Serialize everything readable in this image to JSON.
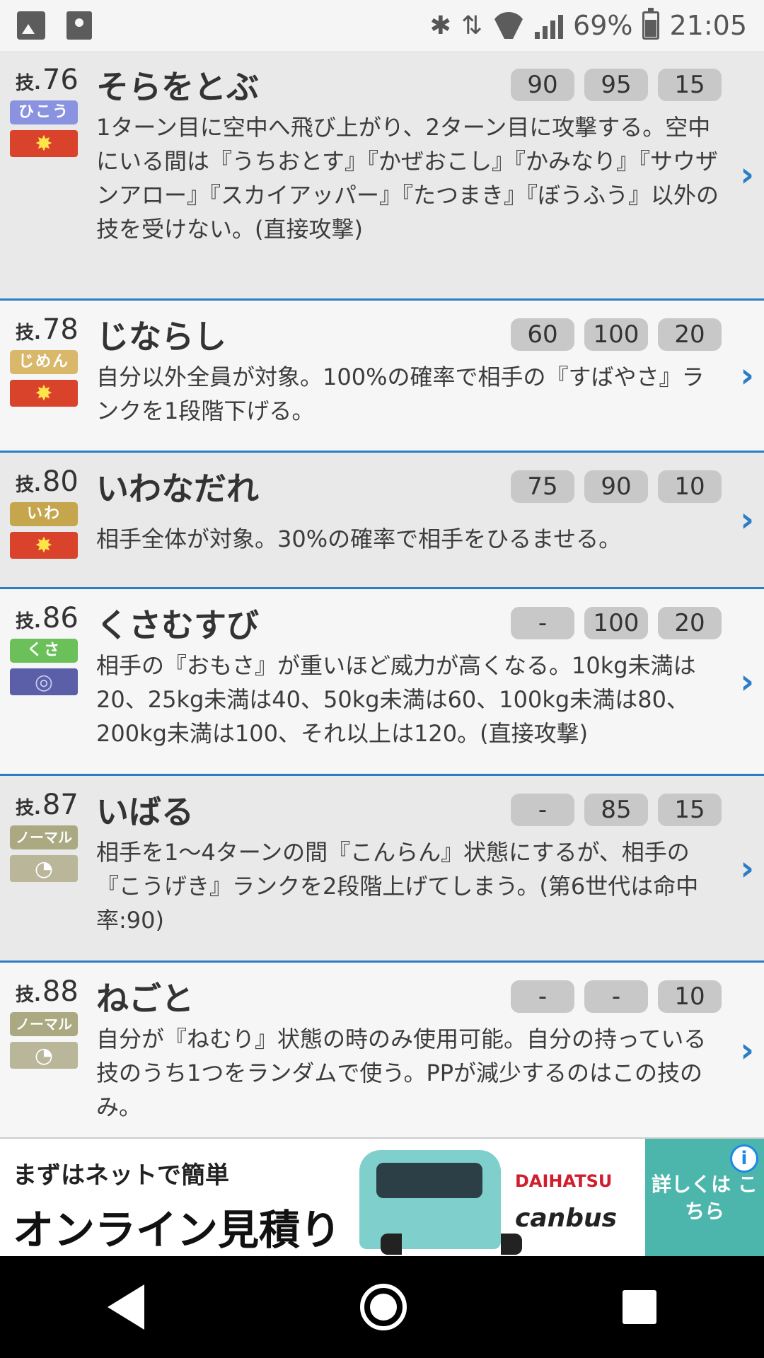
{
  "status_bar": {
    "battery": "69%",
    "time": "21:05",
    "icons": [
      "gallery-icon",
      "contacts-icon",
      "bluetooth-icon",
      "data-icon",
      "wifi-icon",
      "signal-icon",
      "battery-icon"
    ]
  },
  "moves": [
    {
      "label": "技.",
      "number": "76",
      "name": "そらをとぶ",
      "type": "ひこう",
      "type_color": "#8a93e0",
      "category": "physical",
      "stats": [
        "90",
        "95",
        "15"
      ],
      "description": "1ターン目に空中へ飛び上がり、2ターン目に攻撃する。空中にいる間は『うちおとす』『かぜおこし』『かみなり』『サウザンアロー』『スカイアッパー』『たつまき』『ぼうふう』以外の技を受けない。(直接攻撃)"
    },
    {
      "label": "技.",
      "number": "78",
      "name": "じならし",
      "type": "じめん",
      "type_color": "#d9b86c",
      "category": "physical",
      "stats": [
        "60",
        "100",
        "20"
      ],
      "description": "自分以外全員が対象。100%の確率で相手の『すばやさ』ランクを1段階下げる。"
    },
    {
      "label": "技.",
      "number": "80",
      "name": "いわなだれ",
      "type": "いわ",
      "type_color": "#c6a64c",
      "category": "physical",
      "stats": [
        "75",
        "90",
        "10"
      ],
      "description": "相手全体が対象。30%の確率で相手をひるませる。"
    },
    {
      "label": "技.",
      "number": "86",
      "name": "くさむすび",
      "type": "くさ",
      "type_color": "#6cc05a",
      "category": "special",
      "stats": [
        "-",
        "100",
        "20"
      ],
      "description": "相手の『おもさ』が重いほど威力が高くなる。10kg未満は20、25kg未満は40、50kg未満は60、100kg未満は80、200kg未満は100、それ以上は120。(直接攻撃)"
    },
    {
      "label": "技.",
      "number": "87",
      "name": "いばる",
      "type": "ノーマル",
      "type_color": "#aaa982",
      "category": "status",
      "stats": [
        "-",
        "85",
        "15"
      ],
      "description": "相手を1〜4ターンの間『こんらん』状態にするが、相手の『こうげき』ランクを2段階上げてしまう。(第6世代は命中率:90)"
    },
    {
      "label": "技.",
      "number": "88",
      "name": "ねごと",
      "type": "ノーマル",
      "type_color": "#aaa982",
      "category": "status",
      "stats": [
        "-",
        "-",
        "10"
      ],
      "description": "自分が『ねむり』状態の時のみ使用可能。自分の持っている技のうち1つをランダムで使う。PPが減少するのはこの技のみ。"
    }
  ],
  "ad": {
    "line1": "まずはネットで簡単",
    "line2": "オンライン見積り",
    "brand1": "DAIHATSU",
    "brand2": "canbus",
    "cta": "詳しくは こちら",
    "info": "i"
  }
}
